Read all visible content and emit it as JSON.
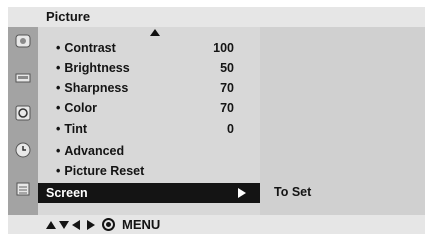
{
  "header": {
    "title": "Picture"
  },
  "sidebar_icons": [
    "picture-menu-icon",
    "audio-menu-icon",
    "timer-menu-icon",
    "clock-menu-icon",
    "setup-menu-icon"
  ],
  "menu": {
    "items": [
      {
        "label": "Contrast",
        "value": "100"
      },
      {
        "label": "Brightness",
        "value": "50"
      },
      {
        "label": "Sharpness",
        "value": "70"
      },
      {
        "label": "Color",
        "value": "70"
      },
      {
        "label": "Tint",
        "value": "0"
      },
      {
        "label": "Advanced",
        "value": ""
      },
      {
        "label": "Picture Reset",
        "value": ""
      }
    ],
    "bullet": "•",
    "selected": {
      "label": "Screen"
    }
  },
  "right_panel": {
    "hint": "To Set"
  },
  "footer": {
    "menu_label": "MENU"
  }
}
